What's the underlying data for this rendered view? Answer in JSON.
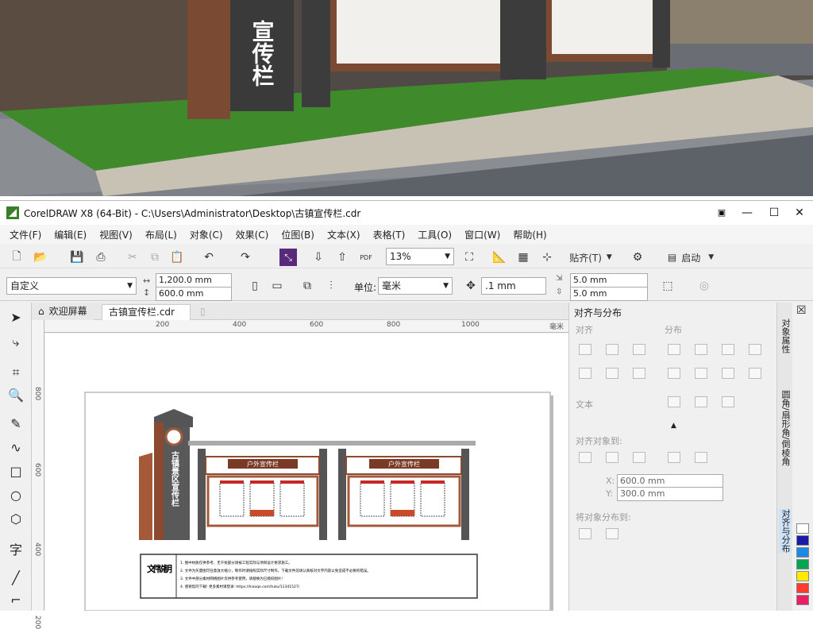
{
  "photo": {
    "sign_text": "宣传栏"
  },
  "window": {
    "title": "CorelDRAW X8 (64-Bit) - C:\\Users\\Administrator\\Desktop\\古镇宣传栏.cdr",
    "controls": {
      "minimize": "—",
      "maximize": "☐",
      "close": "✕"
    }
  },
  "menu": [
    "文件(F)",
    "编辑(E)",
    "视图(V)",
    "布局(L)",
    "对象(C)",
    "效果(C)",
    "位图(B)",
    "文本(X)",
    "表格(T)",
    "工具(O)",
    "窗口(W)",
    "帮助(H)"
  ],
  "toolbar": {
    "zoom": "13%",
    "snap_label": "贴齐(T)",
    "launch_label": "启动"
  },
  "propbar": {
    "preset": "自定义",
    "width": "1,200.0 mm",
    "height": "600.0 mm",
    "unit_label": "单位:",
    "unit": "毫米",
    "nudge": ".1 mm",
    "dup_x": "5.0 mm",
    "dup_y": "5.0 mm"
  },
  "tabs": {
    "welcome": "欢迎屏幕",
    "document": "古镇宣传栏.cdr"
  },
  "ruler": {
    "h_ticks": [
      "200",
      "400",
      "600",
      "800",
      "1000"
    ],
    "h_unit": "毫米",
    "v_ticks": [
      "800",
      "600",
      "400",
      "200"
    ]
  },
  "design": {
    "sign_vertical": "古镇景区宣传栏",
    "board1_title": "户外宣传栏",
    "board2_title": "户外宣传栏",
    "note_title": "文件说明",
    "note_lines": [
      "1. 图中材质仅供参考，无干扰部分请按工程实际与项目设计要求施工。",
      "2. 文件为矢量图可任意放大缩小，制作时请按照实际尺寸制作，下载文件前请认真核对文字内容以免造成不必要的错误。",
      "3. 文件中部分素材网络图片仅供参考使用，请替换为已授权图片!",
      "4. 感谢您的下载! 更多素材请登录: https://hiooqe.com/tuku/11341527/"
    ]
  },
  "docker": {
    "title": "对齐与分布",
    "align": "对齐",
    "distribute": "分布",
    "text": "文本",
    "align_to": "对齐对象到:",
    "x": "600.0 mm",
    "y": "300.0 mm",
    "distribute_to": "将对象分布到:"
  },
  "sidetabs": [
    "对象属性",
    "圆角/扇形角/倒棱角",
    "对齐与分布"
  ],
  "colors": {
    "palette": [
      "#ffffff",
      "#1a1aa8",
      "#1e88e5",
      "#00a651",
      "#ffea00",
      "#ff3b30",
      "#e91e63"
    ],
    "accent": "#3a7d2a"
  }
}
